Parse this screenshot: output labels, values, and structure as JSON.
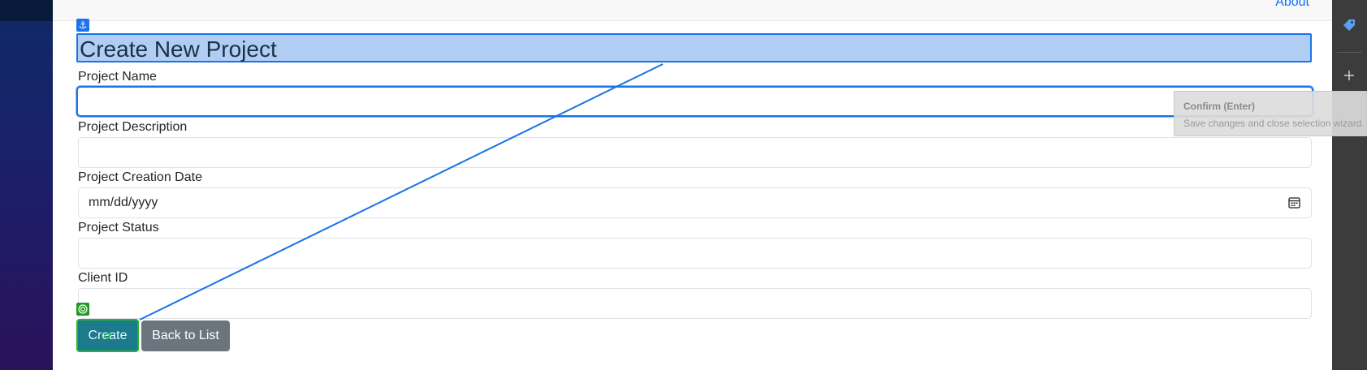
{
  "nav": {
    "about_label": "About"
  },
  "form": {
    "title": "Create New Project",
    "fields": [
      {
        "label": "Project Name",
        "value": ""
      },
      {
        "label": "Project Description",
        "value": ""
      },
      {
        "label": "Project Creation Date",
        "placeholder": "mm/dd/yyyy"
      },
      {
        "label": "Project Status",
        "value": ""
      },
      {
        "label": "Client ID",
        "value": ""
      }
    ],
    "create_label": "Create",
    "back_label": "Back to List"
  },
  "tooltip": {
    "title": "Confirm (Enter)",
    "description": "Save changes and close selection wizard."
  },
  "colors": {
    "selection_blue": "#1a73e8",
    "heading_highlight": "#b0cef3",
    "create_button": "#1b7a8c",
    "back_button": "#6c757d",
    "target_green": "#27b527",
    "link_blue": "#0d6efd"
  },
  "icons": {
    "anchor": "anchor-icon",
    "target": "target-icon",
    "calendar": "calendar-icon",
    "tag": "tag-icon",
    "plus": "plus-icon"
  }
}
